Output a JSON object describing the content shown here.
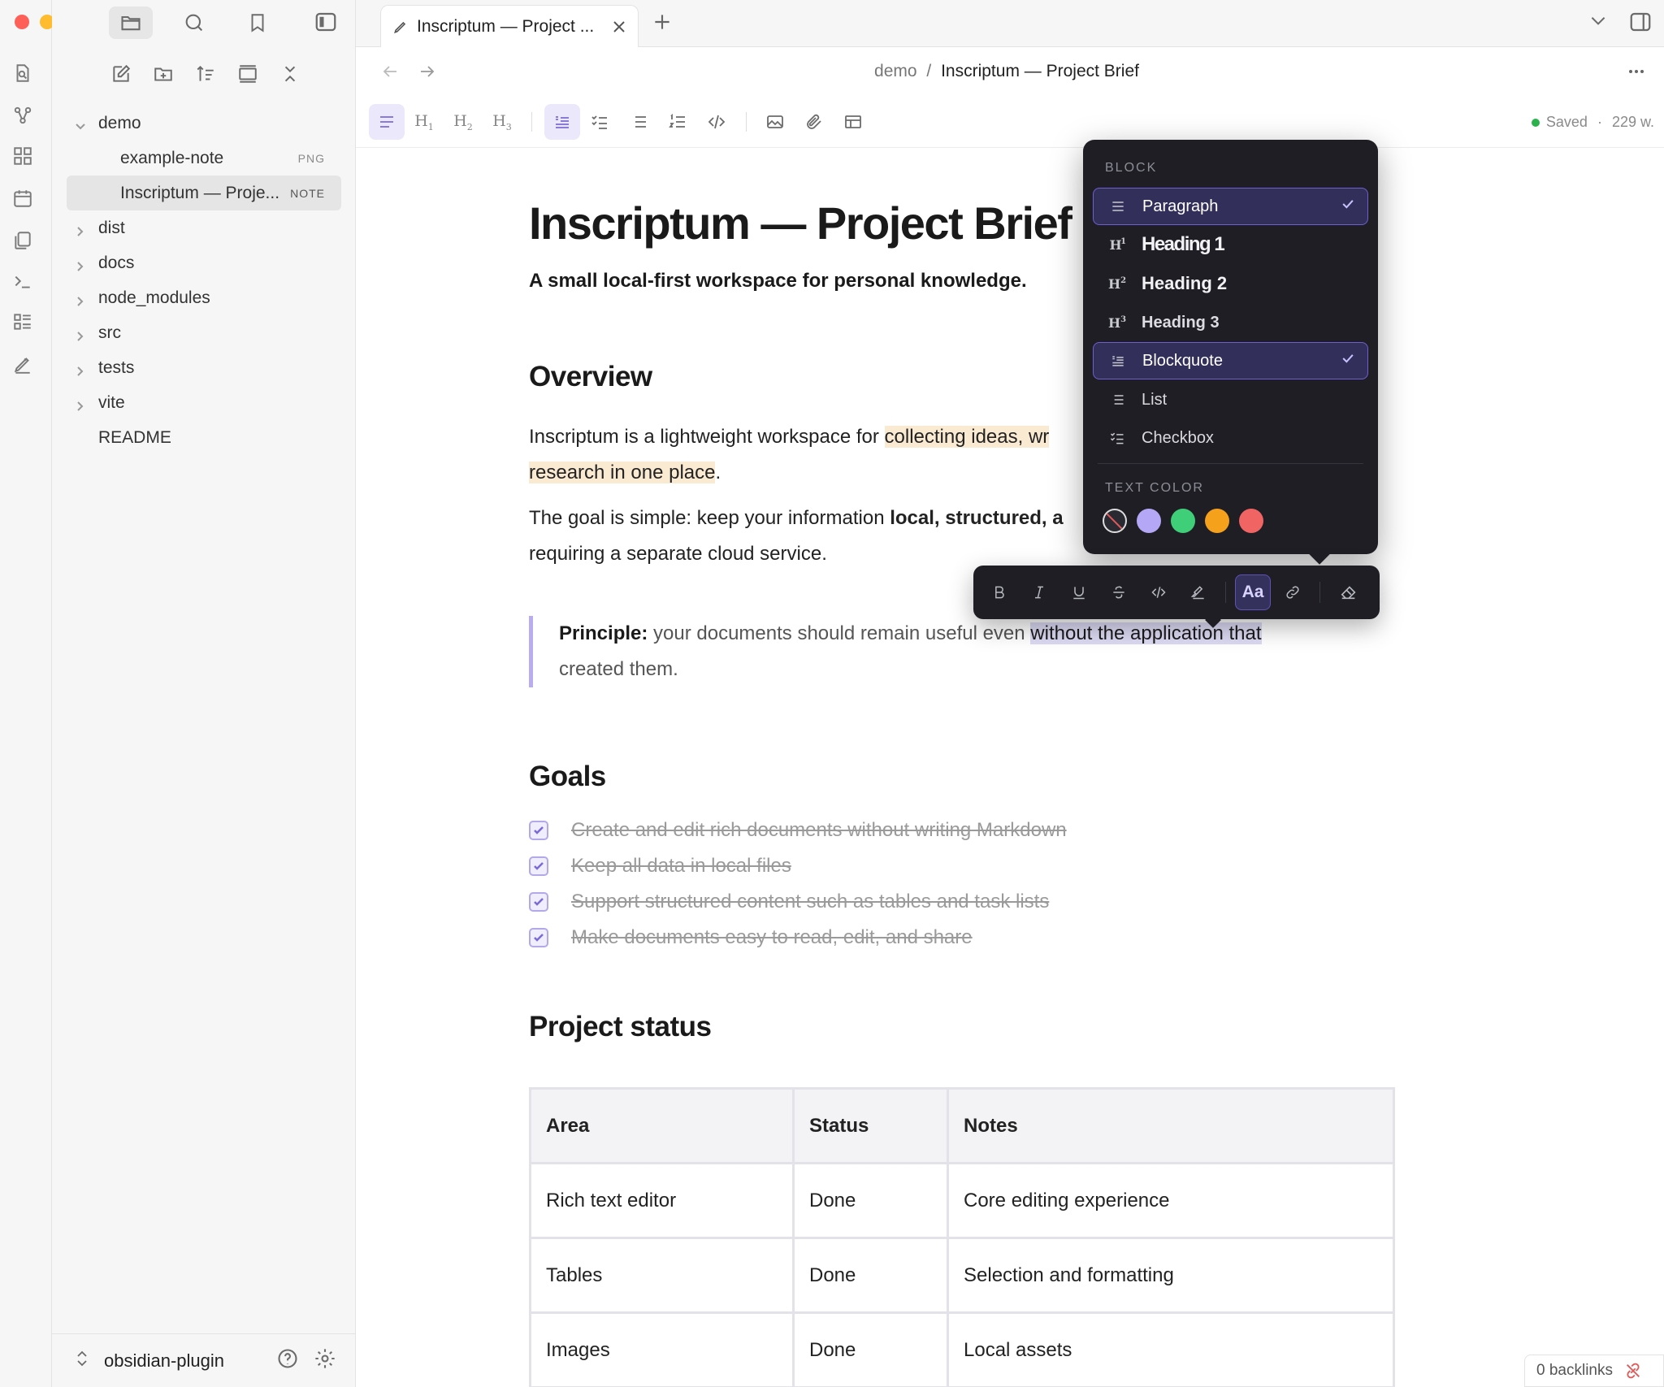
{
  "sidebar": {
    "tree": [
      {
        "label": "demo",
        "expanded": true
      },
      {
        "label": "example-note",
        "tag": "PNG"
      },
      {
        "label": "Inscriptum — Proje...",
        "tag": "NOTE",
        "selected": true
      },
      {
        "label": "dist"
      },
      {
        "label": "docs"
      },
      {
        "label": "node_modules"
      },
      {
        "label": "src"
      },
      {
        "label": "tests"
      },
      {
        "label": "vite"
      },
      {
        "label": "README"
      }
    ],
    "vault_name": "obsidian-plugin"
  },
  "tab": {
    "title": "Inscriptum — Project ..."
  },
  "breadcrumb": {
    "parent": "demo",
    "sep": "/",
    "current": "Inscriptum — Project Brief"
  },
  "status": {
    "saved": "Saved",
    "sep": "·",
    "words": "229 w."
  },
  "doc": {
    "title": "Inscriptum — Project Brief",
    "subtitle": "A small local-first workspace for personal knowledge.",
    "overview_heading": "Overview",
    "p1_a": "Inscriptum is a lightweight workspace for ",
    "p1_hl1": "collecting ideas, wr",
    "p1_hl2": "research in one place",
    "p1_end": ".",
    "p2_a": "The goal is simple: keep your information ",
    "p2_bold": "local, structured, a",
    "p2_b": "requiring a separate cloud service.",
    "quote_label": "Principle:",
    "quote_a": " your documents should remain useful even ",
    "quote_sel": "without the application that",
    "quote_b": "created them.",
    "goals_heading": "Goals",
    "goals": [
      "Create and edit rich documents without writing Markdown",
      "Keep all data in local files",
      "Support structured content such as tables and task lists",
      "Make documents easy to read, edit, and share"
    ],
    "status_heading": "Project status",
    "table": {
      "headers": [
        "Area",
        "Status",
        "Notes"
      ],
      "rows": [
        [
          "Rich text editor",
          "Done",
          "Core editing experience"
        ],
        [
          "Tables",
          "Done",
          "Selection and formatting"
        ],
        [
          "Images",
          "Done",
          "Local assets"
        ]
      ]
    }
  },
  "popover": {
    "block_label": "BLOCK",
    "items": [
      "Paragraph",
      "Heading 1",
      "Heading 2",
      "Heading 3",
      "Blockquote",
      "List",
      "Checkbox"
    ],
    "text_color_label": "TEXT COLOR",
    "colors": [
      "none",
      "#b4a7f5",
      "#3ecf78",
      "#f5a11c",
      "#f06464"
    ]
  },
  "inline_toolbar": {
    "text_style": "Aa"
  },
  "backlinks": {
    "label": "0 backlinks"
  },
  "colors": {
    "accent": "#7c6ad6",
    "highlight": "#fbead2",
    "selection": "#dcdaf3",
    "popover_bg": "#1e1e24"
  }
}
